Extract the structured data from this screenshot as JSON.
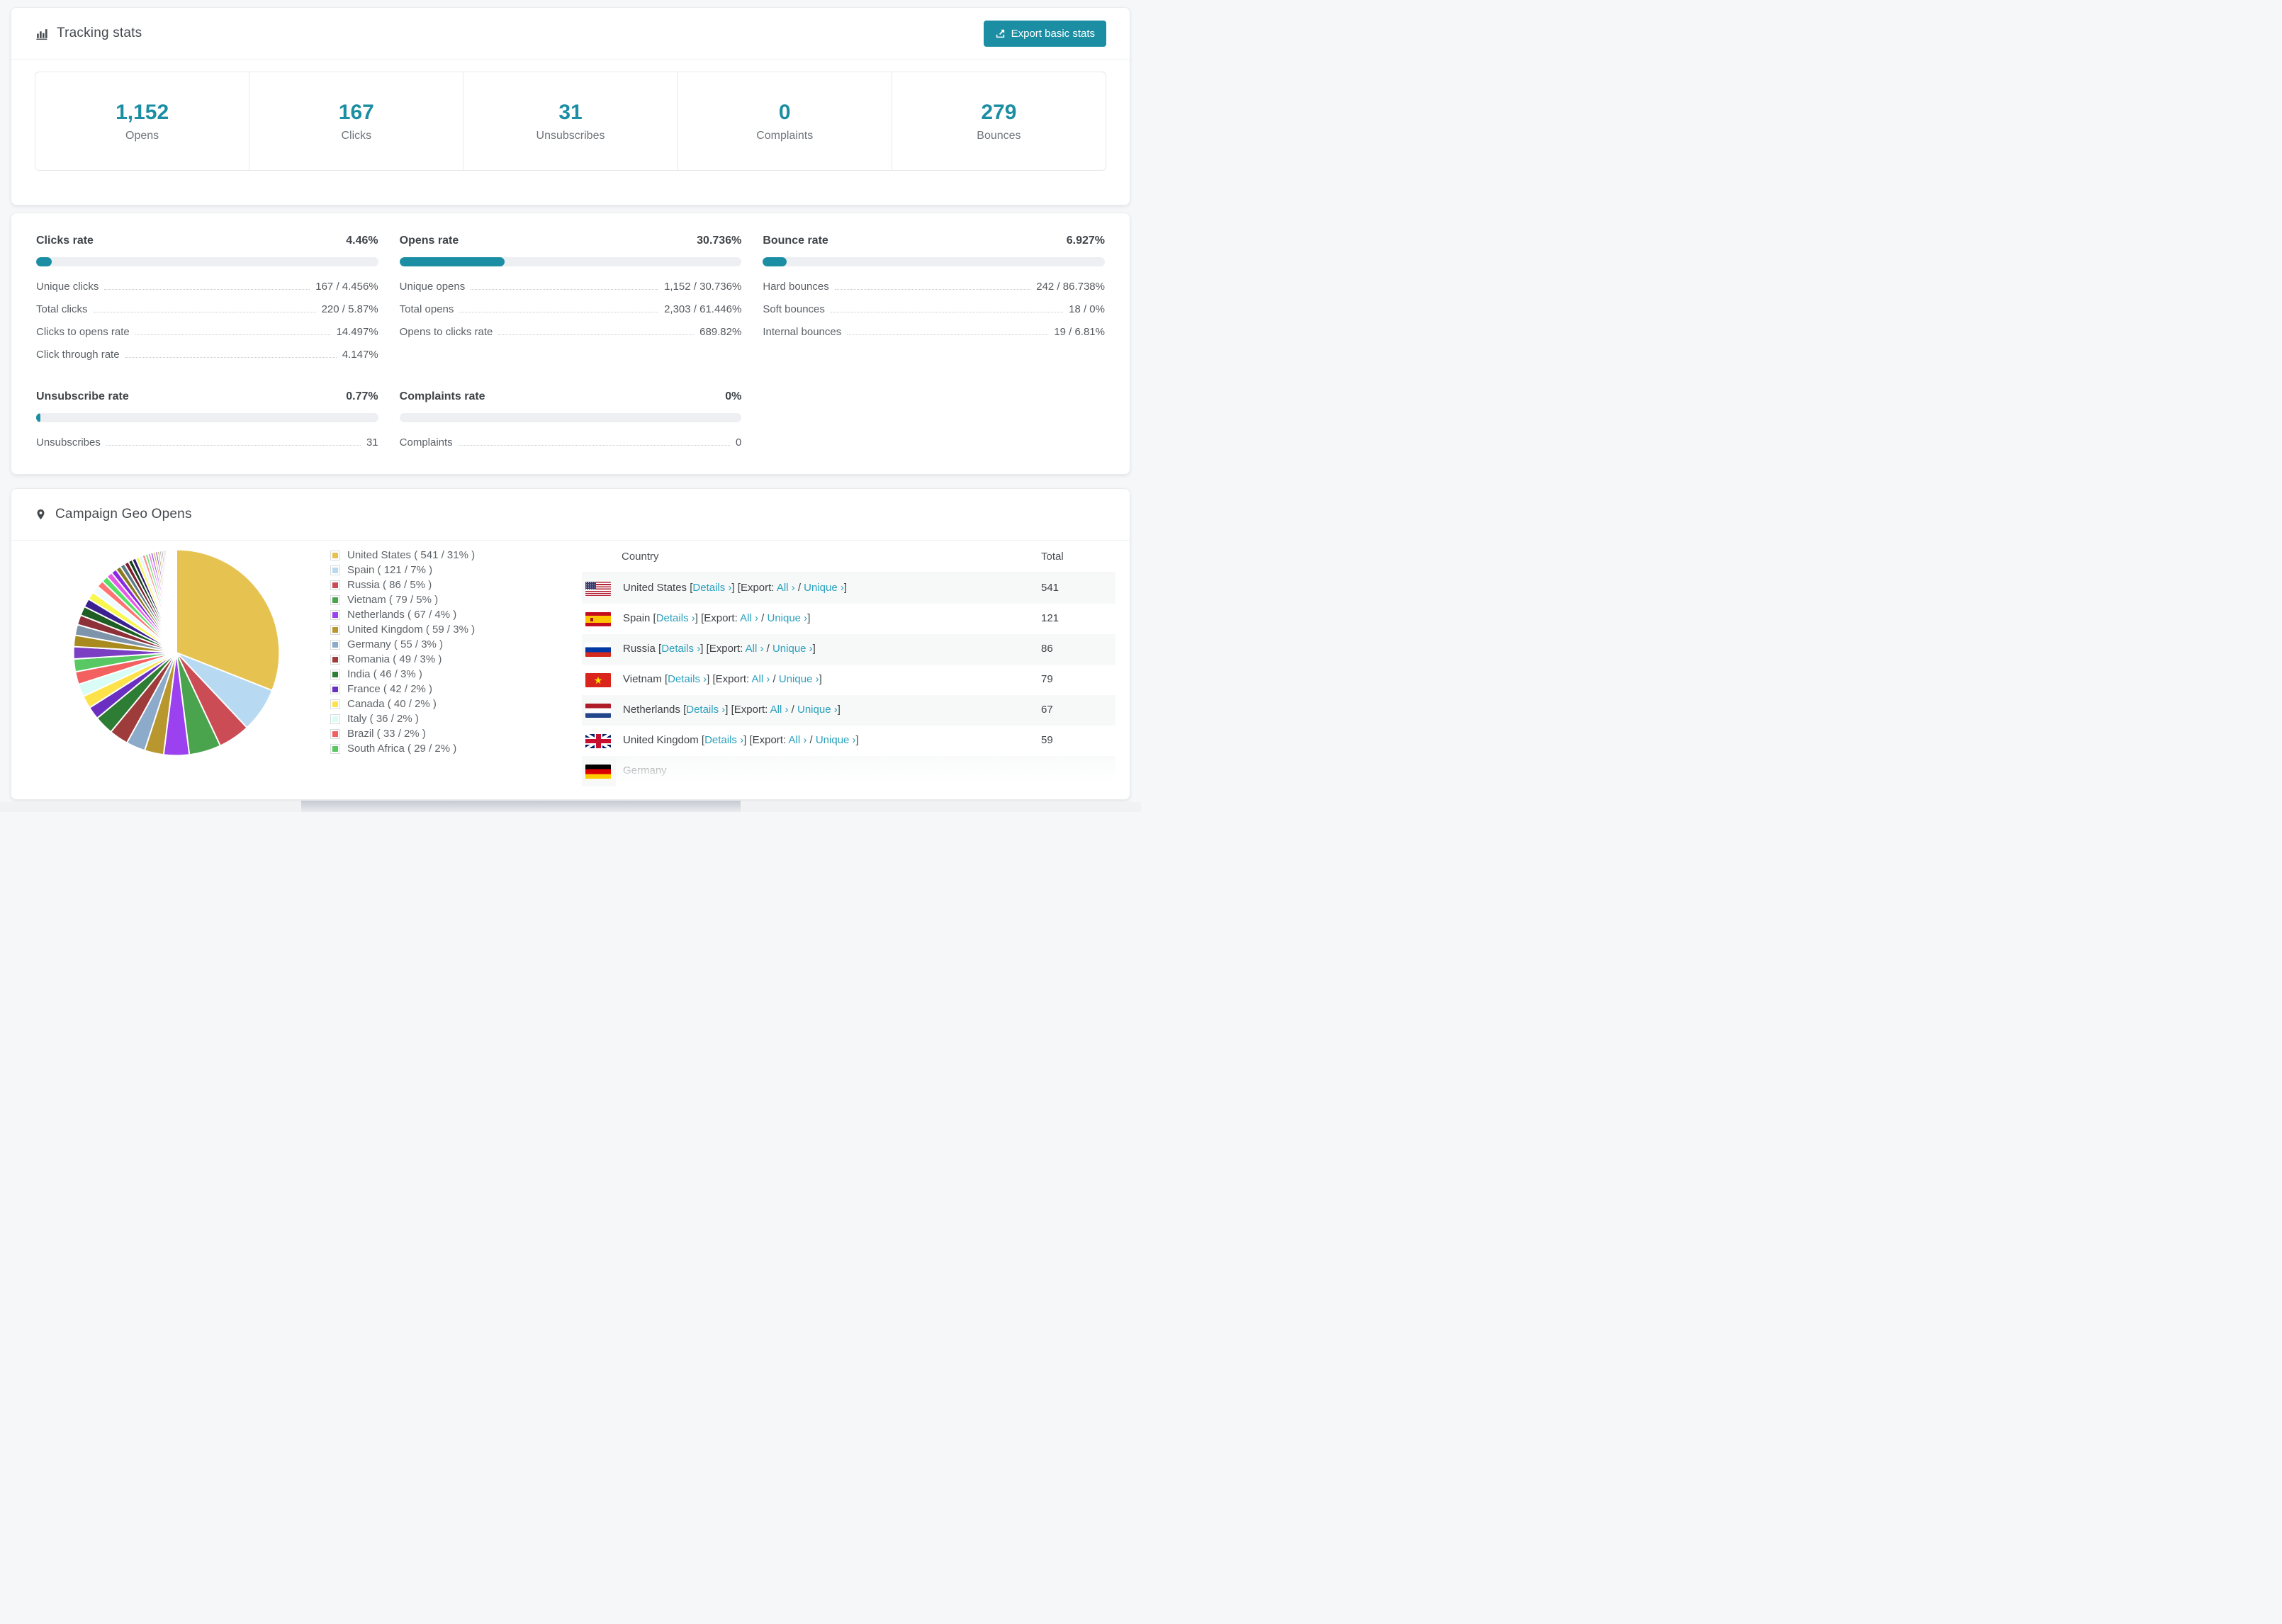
{
  "accent": "#1b8ea3",
  "tracking": {
    "title": "Tracking stats",
    "export_label": "Export basic stats",
    "stats": [
      {
        "value": "1,152",
        "label": "Opens"
      },
      {
        "value": "167",
        "label": "Clicks"
      },
      {
        "value": "31",
        "label": "Unsubscribes"
      },
      {
        "value": "0",
        "label": "Complaints"
      },
      {
        "value": "279",
        "label": "Bounces"
      }
    ]
  },
  "rates": {
    "panels": [
      {
        "title": "Clicks rate",
        "value": "4.46%",
        "pct": 4.46,
        "rows": [
          {
            "label": "Unique clicks",
            "value": "167 / 4.456%"
          },
          {
            "label": "Total clicks",
            "value": "220 / 5.87%"
          },
          {
            "label": "Clicks to opens rate",
            "value": "14.497%"
          },
          {
            "label": "Click through rate",
            "value": "4.147%"
          }
        ]
      },
      {
        "title": "Opens rate",
        "value": "30.736%",
        "pct": 30.736,
        "rows": [
          {
            "label": "Unique opens",
            "value": "1,152 / 30.736%"
          },
          {
            "label": "Total opens",
            "value": "2,303 / 61.446%"
          },
          {
            "label": "Opens to clicks rate",
            "value": "689.82%"
          }
        ]
      },
      {
        "title": "Bounce rate",
        "value": "6.927%",
        "pct": 6.927,
        "rows": [
          {
            "label": "Hard bounces",
            "value": "242 / 86.738%"
          },
          {
            "label": "Soft bounces",
            "value": "18 / 0%"
          },
          {
            "label": "Internal bounces",
            "value": "19 / 6.81%"
          }
        ]
      },
      {
        "title": "Unsubscribe rate",
        "value": "0.77%",
        "pct": 0.77,
        "rows": [
          {
            "label": "Unsubscribes",
            "value": "31"
          }
        ]
      },
      {
        "title": "Complaints rate",
        "value": "0%",
        "pct": 0,
        "rows": [
          {
            "label": "Complaints",
            "value": "0"
          }
        ]
      }
    ]
  },
  "geo": {
    "title": "Campaign Geo Opens",
    "legend": [
      {
        "text": "United States ( 541 / 31% )",
        "color": "#e6c351"
      },
      {
        "text": "Spain ( 121 / 7% )",
        "color": "#b8d9f2"
      },
      {
        "text": "Russia ( 86 / 5% )",
        "color": "#cc4c55"
      },
      {
        "text": "Vietnam ( 79 / 5% )",
        "color": "#4aa44e"
      },
      {
        "text": "Netherlands ( 67 / 4% )",
        "color": "#9b41f0"
      },
      {
        "text": "United Kingdom ( 59 / 3% )",
        "color": "#b9972f"
      },
      {
        "text": "Germany ( 55 / 3% )",
        "color": "#8caac9"
      },
      {
        "text": "Romania ( 49 / 3% )",
        "color": "#9e3b3b"
      },
      {
        "text": "India ( 46 / 3% )",
        "color": "#2e7d34"
      },
      {
        "text": "France ( 42 / 2% )",
        "color": "#6a2fc0"
      },
      {
        "text": "Canada ( 40 / 2% )",
        "color": "#fde24a"
      },
      {
        "text": "Italy ( 36 / 2% )",
        "color": "#d9fcf6"
      },
      {
        "text": "Brazil ( 33 / 2% )",
        "color": "#f26060"
      },
      {
        "text": "South Africa ( 29 / 2% )",
        "color": "#58c863"
      }
    ],
    "table": {
      "headers": [
        "Country",
        "Total"
      ],
      "fmt": {
        "lb": "[",
        "rb": "]",
        "details": "Details ›",
        "export_label": "Export:",
        "all": "All ›",
        "slash": "/",
        "unique": "Unique ›"
      },
      "rows": [
        {
          "name": "United States",
          "total": "541",
          "flag": "us"
        },
        {
          "name": "Spain",
          "total": "121",
          "flag": "es"
        },
        {
          "name": "Russia",
          "total": "86",
          "flag": "ru"
        },
        {
          "name": "Vietnam",
          "total": "79",
          "flag": "vn"
        },
        {
          "name": "Netherlands",
          "total": "67",
          "flag": "nl"
        },
        {
          "name": "United Kingdom",
          "total": "59",
          "flag": "gb"
        },
        {
          "name": "Germany",
          "total": "",
          "flag": "de"
        }
      ]
    }
  },
  "chart_data": {
    "type": "pie",
    "title": "Campaign Geo Opens",
    "legend_position": "right",
    "start_angle": "top",
    "direction": "clockwise",
    "series": [
      {
        "name": "United States",
        "value": 541,
        "pct": 31,
        "color": "#e6c351"
      },
      {
        "name": "Spain",
        "value": 121,
        "pct": 7,
        "color": "#b8d9f2"
      },
      {
        "name": "Russia",
        "value": 86,
        "pct": 5,
        "color": "#cc4c55"
      },
      {
        "name": "Vietnam",
        "value": 79,
        "pct": 5,
        "color": "#4aa44e"
      },
      {
        "name": "Netherlands",
        "value": 67,
        "pct": 4,
        "color": "#9b41f0"
      },
      {
        "name": "United Kingdom",
        "value": 59,
        "pct": 3,
        "color": "#b9972f"
      },
      {
        "name": "Germany",
        "value": 55,
        "pct": 3,
        "color": "#8caac9"
      },
      {
        "name": "Romania",
        "value": 49,
        "pct": 3,
        "color": "#9e3b3b"
      },
      {
        "name": "India",
        "value": 46,
        "pct": 3,
        "color": "#2e7d34"
      },
      {
        "name": "France",
        "value": 42,
        "pct": 2,
        "color": "#6a2fc0"
      },
      {
        "name": "Canada",
        "value": 40,
        "pct": 2,
        "color": "#fde24a"
      },
      {
        "name": "Italy",
        "value": 36,
        "pct": 2,
        "color": "#d9fcf6"
      },
      {
        "name": "Brazil",
        "value": 33,
        "pct": 2,
        "color": "#f26060"
      },
      {
        "name": "South Africa",
        "value": 29,
        "pct": 2,
        "color": "#58c863"
      }
    ],
    "unlabeled_small_slices": {
      "count": 40,
      "decay": 0.93,
      "palette": [
        "#7b3fc4",
        "#a88a1e",
        "#7e94aa",
        "#8e3038",
        "#1e5e22",
        "#3b2190",
        "#f7f74d",
        "#eefcff",
        "#ff7373",
        "#54e063",
        "#e659e6",
        "#8a2be2",
        "#8a7a1f",
        "#5c7a8c",
        "#7a1f2b",
        "#16421a",
        "#2d1b69",
        "#f5f560",
        "#dff7ff",
        "#ff8c8c",
        "#70e87d",
        "#f07de8",
        "#a55ce8",
        "#c8b445"
      ]
    }
  }
}
